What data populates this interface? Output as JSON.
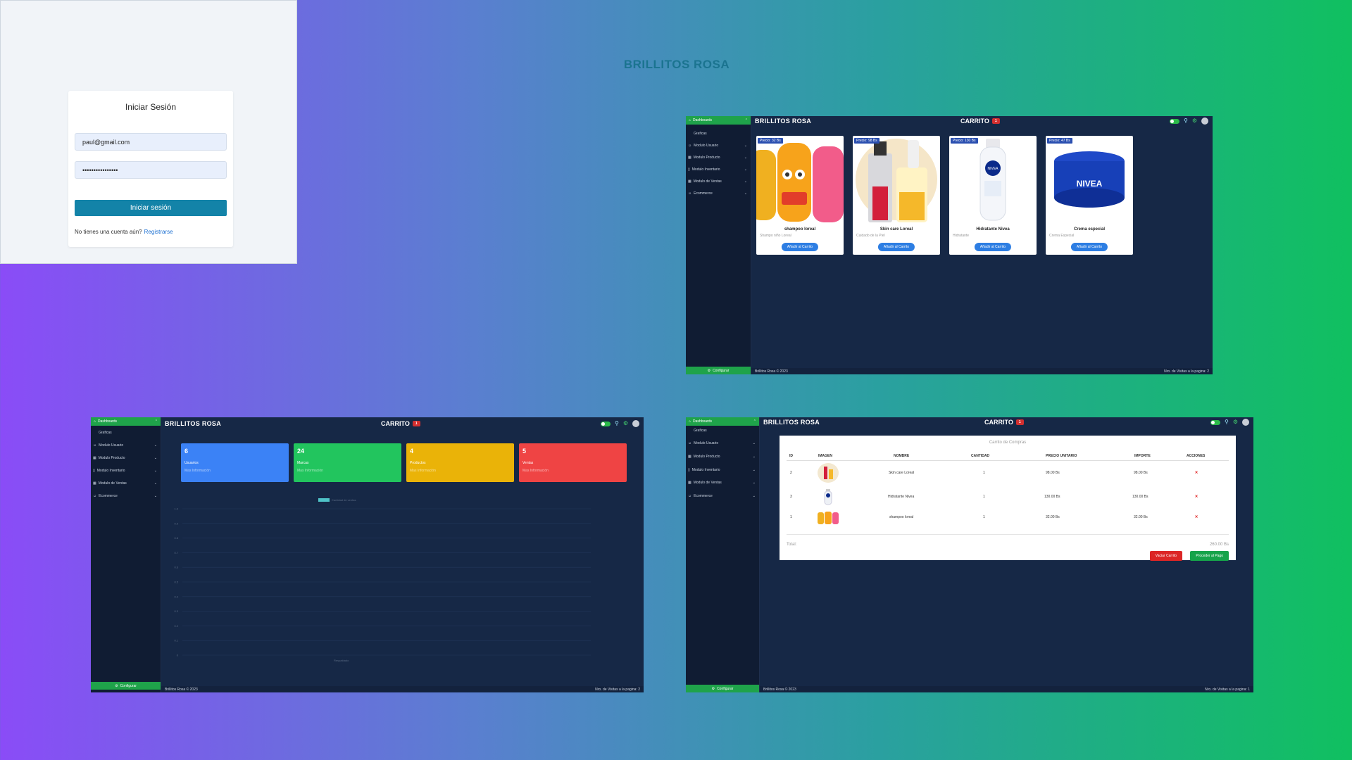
{
  "brand": "BRILLITOS ROSA",
  "login": {
    "title": "Iniciar Sesión",
    "email_value": "paul@gmail.com",
    "password_value": "••••••••••••••••",
    "submit_label": "Iniciar sesión",
    "register_prompt": "No tienes una cuenta aún?",
    "register_link": "Registrarse"
  },
  "shell": {
    "cart_label": "CARRITO",
    "cart_badge": "1",
    "sidebar": {
      "dashboard": "Dashboards",
      "graficas": "Graficas",
      "items": [
        "Modulo Usuario",
        "Modulo Producto",
        "Modulo Inventario",
        "Modulo de Ventas",
        "Ecommerce"
      ],
      "configurar": "Configurar"
    },
    "footer_left": "Brillitos Rosa © 2023",
    "footer_right_page2": "Nro. de Visitas a la pagina: 2",
    "footer_right_page1": "Nro. de Visitas a la pagina: 1"
  },
  "products": [
    {
      "price": "Precio: 32 Bs",
      "name": "shampoo loreal",
      "desc": "Shampo niño Loreal",
      "add": "Añadir al Carrito"
    },
    {
      "price": "Precio: 98 Bs",
      "name": "Skin care Loreal",
      "desc": "Cuidado de la Piel",
      "add": "Añadir al Carrito"
    },
    {
      "price": "Precio: 130 Bs",
      "name": "Hidratante Nivea",
      "desc": "Hidratante",
      "add": "Añadir al Carrito"
    },
    {
      "price": "Precio: 47 Bs",
      "name": "Crema especial",
      "desc": "Crema Especial",
      "add": "Añadir al Carrito"
    }
  ],
  "stats": [
    {
      "value": "6",
      "label": "Usuarios",
      "more": "Mas Información",
      "color": "#3b82f6"
    },
    {
      "value": "24",
      "label": "Marcas",
      "more": "Mas Información",
      "color": "#22c55e"
    },
    {
      "value": "4",
      "label": "Productos",
      "more": "Mas Información",
      "color": "#eab308"
    },
    {
      "value": "5",
      "label": "Ventas",
      "more": "Mas Información",
      "color": "#ef4444"
    }
  ],
  "chart": {
    "legend": "Cantidad de ventas",
    "xlabel": "Respaldado",
    "yticks": [
      "1.0",
      "0.9",
      "0.8",
      "0.7",
      "0.6",
      "0.5",
      "0.4",
      "0.3",
      "0.2",
      "0.1",
      "0"
    ]
  },
  "cart_table": {
    "title": "Carrito de Compras",
    "headers": [
      "ID",
      "IMAGEN",
      "NOMBRE",
      "CANTIDAD",
      "PRECIO UNITARIO",
      "IMPORTE",
      "ACCIONES"
    ],
    "rows": [
      {
        "id": "2",
        "name": "Skin care Loreal",
        "qty": "1",
        "unit": "98.00 Bs",
        "total": "98.00 Bs",
        "action": "×"
      },
      {
        "id": "3",
        "name": "Hidratante Nivea",
        "qty": "1",
        "unit": "130.00 Bs",
        "total": "130.00 Bs",
        "action": "×"
      },
      {
        "id": "1",
        "name": "shampoo loreal",
        "qty": "1",
        "unit": "32.00 Bs",
        "total": "32.00 Bs",
        "action": "×"
      }
    ],
    "total_label": "Total:",
    "total_value": "260.00 Bs",
    "empty_label": "Vaciar Carrito",
    "pay_label": "Proceder al Pago"
  },
  "colors": {
    "accent_green": "#1fa34a",
    "bg_dark": "#162846",
    "sidebar": "#101c33"
  }
}
